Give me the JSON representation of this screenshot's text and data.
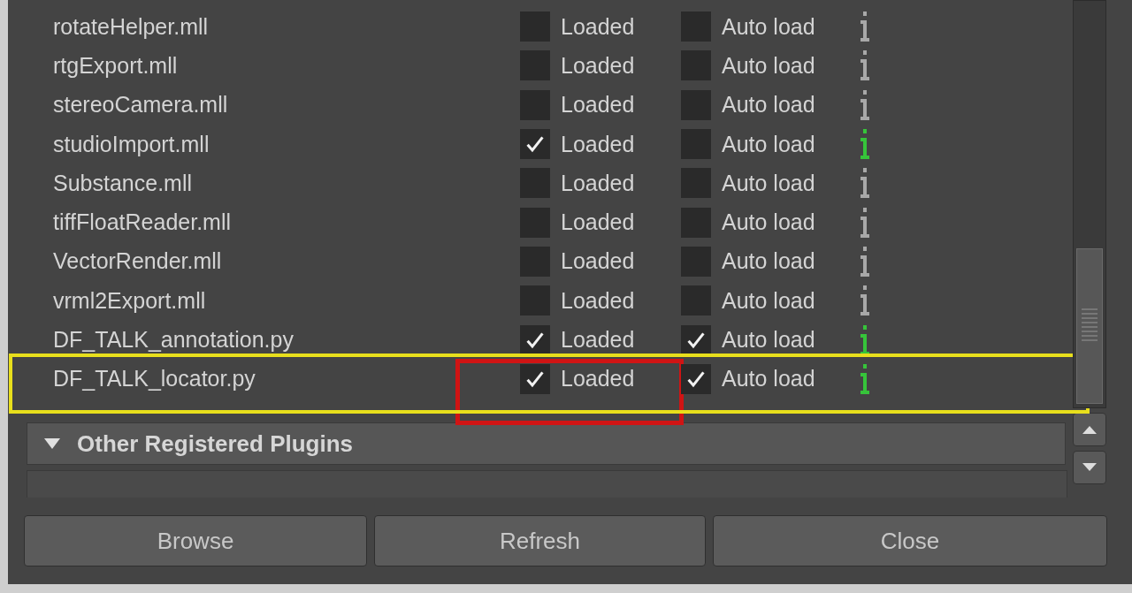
{
  "plugins": [
    {
      "name": "rotateHelper.mll",
      "loaded": false,
      "auto_load": false,
      "loaded_label": "Loaded",
      "auto_load_label": "Auto load"
    },
    {
      "name": "rtgExport.mll",
      "loaded": false,
      "auto_load": false,
      "loaded_label": "Loaded",
      "auto_load_label": "Auto load"
    },
    {
      "name": "stereoCamera.mll",
      "loaded": false,
      "auto_load": false,
      "loaded_label": "Loaded",
      "auto_load_label": "Auto load"
    },
    {
      "name": "studioImport.mll",
      "loaded": true,
      "auto_load": false,
      "loaded_label": "Loaded",
      "auto_load_label": "Auto load"
    },
    {
      "name": "Substance.mll",
      "loaded": false,
      "auto_load": false,
      "loaded_label": "Loaded",
      "auto_load_label": "Auto load"
    },
    {
      "name": "tiffFloatReader.mll",
      "loaded": false,
      "auto_load": false,
      "loaded_label": "Loaded",
      "auto_load_label": "Auto load"
    },
    {
      "name": "VectorRender.mll",
      "loaded": false,
      "auto_load": false,
      "loaded_label": "Loaded",
      "auto_load_label": "Auto load"
    },
    {
      "name": "vrml2Export.mll",
      "loaded": false,
      "auto_load": false,
      "loaded_label": "Loaded",
      "auto_load_label": "Auto load"
    },
    {
      "name": "DF_TALK_annotation.py",
      "loaded": true,
      "auto_load": true,
      "loaded_label": "Loaded",
      "auto_load_label": "Auto load"
    },
    {
      "name": "DF_TALK_locator.py",
      "loaded": true,
      "auto_load": true,
      "loaded_label": "Loaded",
      "auto_load_label": "Auto load",
      "highlight": {
        "color": "#e8df1c"
      },
      "loaded_highlight": {
        "color": "#d01414"
      }
    }
  ],
  "section": {
    "title": "Other Registered Plugins",
    "expanded": true
  },
  "buttons": [
    "Browse",
    "Refresh",
    "Close"
  ]
}
